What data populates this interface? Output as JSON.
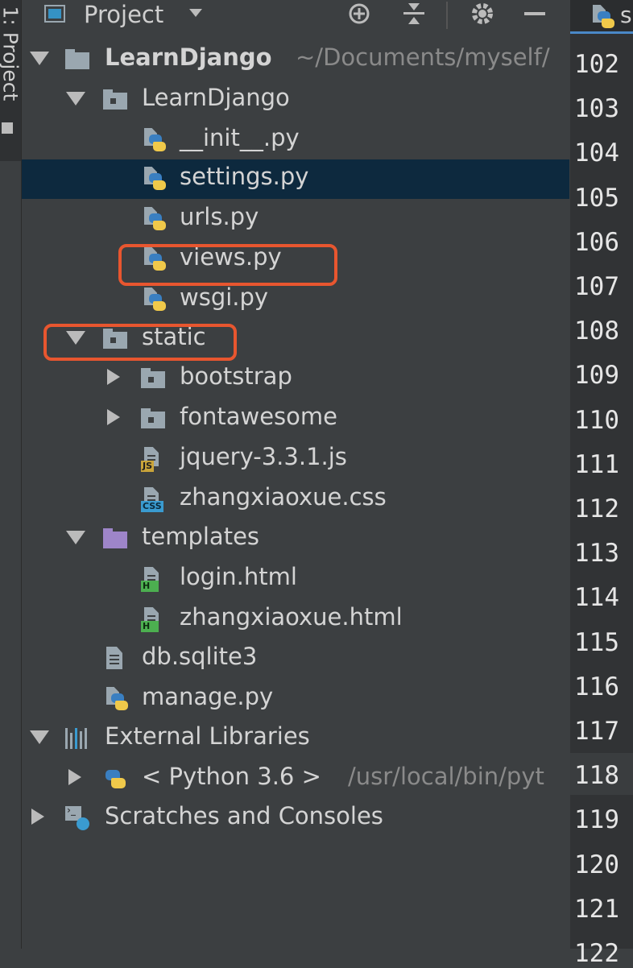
{
  "toolwindow": {
    "stripe_label": "1: Project"
  },
  "header": {
    "title": "Project",
    "buttons": [
      "locate-icon",
      "collapse-icon",
      "gear-icon",
      "hide-icon"
    ]
  },
  "editor_tab": {
    "label": "s"
  },
  "tree": {
    "root": {
      "name": "LearnDjango",
      "path": "~/Documents/myself/"
    },
    "pkg": {
      "name": "LearnDjango"
    },
    "files_pkg": [
      "__init__.py",
      "settings.py",
      "urls.py",
      "views.py",
      "wsgi.py"
    ],
    "static": {
      "name": "static"
    },
    "static_children": [
      "bootstrap",
      "fontawesome",
      "jquery-3.3.1.js",
      "zhangxiaoxue.css"
    ],
    "templates": {
      "name": "templates"
    },
    "templates_children": [
      "login.html",
      "zhangxiaoxue.html"
    ],
    "db": "db.sqlite3",
    "manage": "manage.py",
    "external": "External Libraries",
    "python": {
      "name": "< Python 3.6 >",
      "path": "/usr/local/bin/pyt"
    },
    "scratches": "Scratches and Consoles",
    "file_tags": {
      "js": "JS",
      "css": "CSS",
      "html": "H"
    }
  },
  "gutter": {
    "line_numbers": [
      "102",
      "103",
      "104",
      "105",
      "106",
      "107",
      "108",
      "109",
      "110",
      "111",
      "112",
      "113",
      "114",
      "115",
      "116",
      "117",
      "118",
      "119",
      "120",
      "121",
      "122"
    ]
  },
  "colors": {
    "selection": "#0d293e",
    "highlight": "#e8562f",
    "panel_bg": "#3c3f41"
  }
}
